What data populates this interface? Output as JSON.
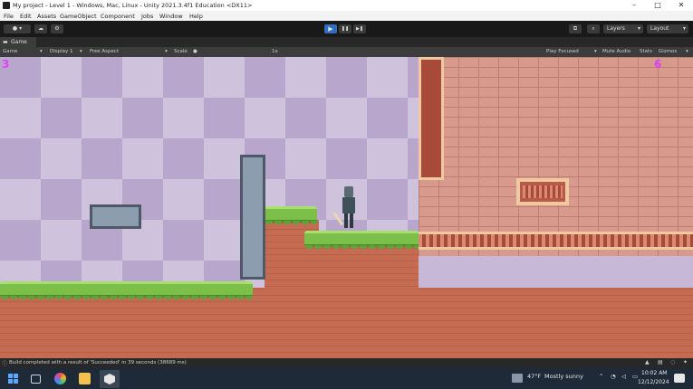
{
  "window": {
    "title": "My project - Level 1 - Windows, Mac, Linux - Unity 2021.3.4f1 Education <DX11>",
    "min_glyph": "–",
    "max_glyph": "□",
    "close_glyph": "✕"
  },
  "menu": [
    "File",
    "Edit",
    "Assets",
    "GameObject",
    "Component",
    "Jobs",
    "Window",
    "Help"
  ],
  "toolbar": {
    "layers_label": "Layers",
    "layout_label": "Layout",
    "play_glyph": "▶",
    "pause_glyph": "❚❚",
    "step_glyph": "▶❚"
  },
  "game_tab": {
    "label": "Game"
  },
  "game_toolbar": {
    "mode": "Game",
    "display": "Display 1",
    "aspect": "Free Aspect",
    "scale_label": "Scale",
    "scale_value": "1x",
    "play_focused": "Play Focused",
    "mute_audio": "Mute Audio",
    "stats": "Stats",
    "gizmos": "Gizmos"
  },
  "game": {
    "left_marker": "3",
    "right_marker": "6"
  },
  "status": {
    "message": "Build completed with a result of 'Succeeded' in 39 seconds (38689 ms)"
  },
  "taskbar": {
    "weather_temp": "47°F",
    "weather_text": "Mostly sunny",
    "time": "10:02 AM",
    "date": "12/12/2024"
  },
  "colors": {
    "accent_play": "#2f6fbd",
    "marker": "#e040fb"
  }
}
